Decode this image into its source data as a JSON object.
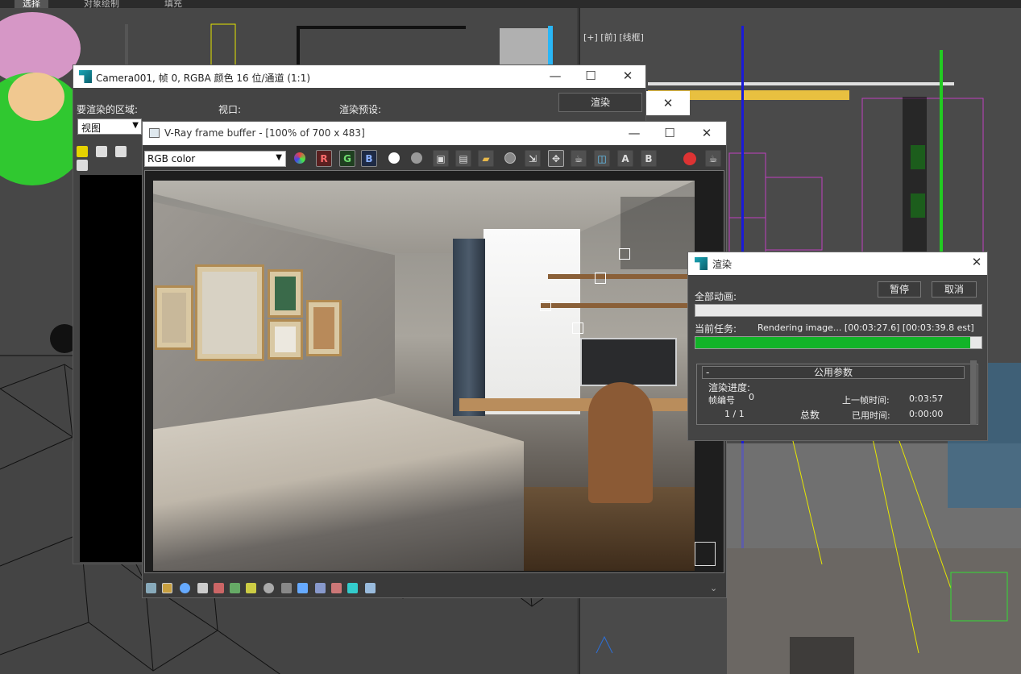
{
  "app_tabs": [
    "选择",
    "对象绘制",
    "填充"
  ],
  "viewport_right_label": "[+] [前] [线框]",
  "camera_window": {
    "title": "Camera001, 帧 0, RGBA 颜色 16 位/通道 (1:1)",
    "area_label": "要渲染的区域:",
    "area_value": "视图",
    "viewport_label": "视口:",
    "preset_label": "渲染预设:",
    "render_button": "渲染"
  },
  "vfb": {
    "title": "V-Ray frame buffer - [100% of 700 x 483]",
    "channel_select": "RGB color",
    "btn_r": "R",
    "btn_g": "G",
    "btn_b": "B"
  },
  "render_progress": {
    "title": "渲染",
    "all_anim_label": "全部动画:",
    "pause_button": "暂停",
    "cancel_button": "取消",
    "current_task_label": "当前任务:",
    "current_task_value": "Rendering image... [00:03:27.6] [00:03:39.8 est]",
    "all_anim_progress": 0,
    "current_task_progress": 0.96,
    "group_title": "公用参数",
    "group_collapse": "-",
    "render_progress_label": "渲染进度:",
    "frame_num_label": "帧编号",
    "frame_num_value": "0",
    "last_frame_time_label": "上一帧时间:",
    "last_frame_time_value": "0:03:57",
    "frames_value": "1  / 1",
    "total_label": "总数",
    "elapsed_label": "已用时间:",
    "elapsed_value": "0:00:00"
  },
  "colors": {
    "accent_green": "#12b428",
    "title_bg": "#ffffff",
    "panel_bg": "#444444"
  }
}
